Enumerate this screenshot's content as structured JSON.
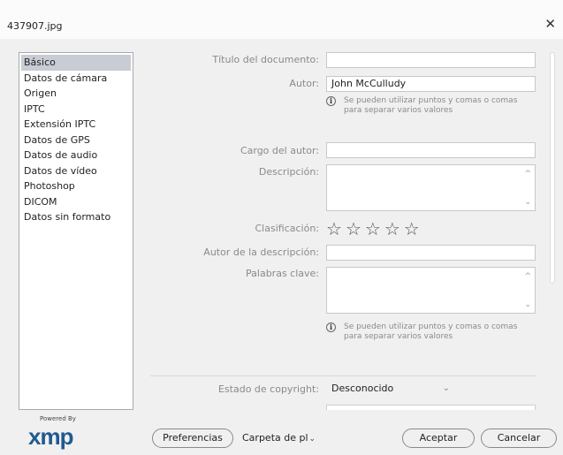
{
  "window": {
    "title": "437907.jpg"
  },
  "sidebar": {
    "items": [
      {
        "label": "Básico",
        "selected": true
      },
      {
        "label": "Datos de cámara"
      },
      {
        "label": "Origen"
      },
      {
        "label": "IPTC"
      },
      {
        "label": "Extensión IPTC"
      },
      {
        "label": "Datos de GPS"
      },
      {
        "label": "Datos de audio"
      },
      {
        "label": "Datos de vídeo"
      },
      {
        "label": "Photoshop"
      },
      {
        "label": "DICOM"
      },
      {
        "label": "Datos sin formato"
      }
    ]
  },
  "form": {
    "title_label": "Título del documento:",
    "title_value": "",
    "author_label": "Autor:",
    "author_value": "John McCulludy",
    "author_hint": "Se pueden utilizar puntos y comas o comas para separar varios valores",
    "author_position_label": "Cargo del autor:",
    "author_position_value": "",
    "description_label": "Descripción:",
    "rating_label": "Clasificación:",
    "rating_value": 0,
    "rating_max": 5,
    "description_writer_label": "Autor de la descripción:",
    "keywords_label": "Palabras clave:",
    "keywords_hint": "Se pueden utilizar puntos y comas o comas para separar varios valores",
    "copyright_status_label": "Estado de copyright:",
    "copyright_status_value": "Desconocido"
  },
  "footer": {
    "powered_by": "Powered By",
    "logo_text": "xmp",
    "preferences_label": "Preferencias",
    "template_folder_label": "Carpeta de pl",
    "ok_label": "Aceptar",
    "cancel_label": "Cancelar"
  },
  "icons": {
    "close": "close-icon",
    "info": "info-icon",
    "star": "star-outline-icon",
    "chevron": "chevron-down-icon"
  },
  "colors": {
    "dialog_bg": "#f0f0f0",
    "selection": "#c8ccd4",
    "xmp_blue": "#1f5a8f"
  }
}
